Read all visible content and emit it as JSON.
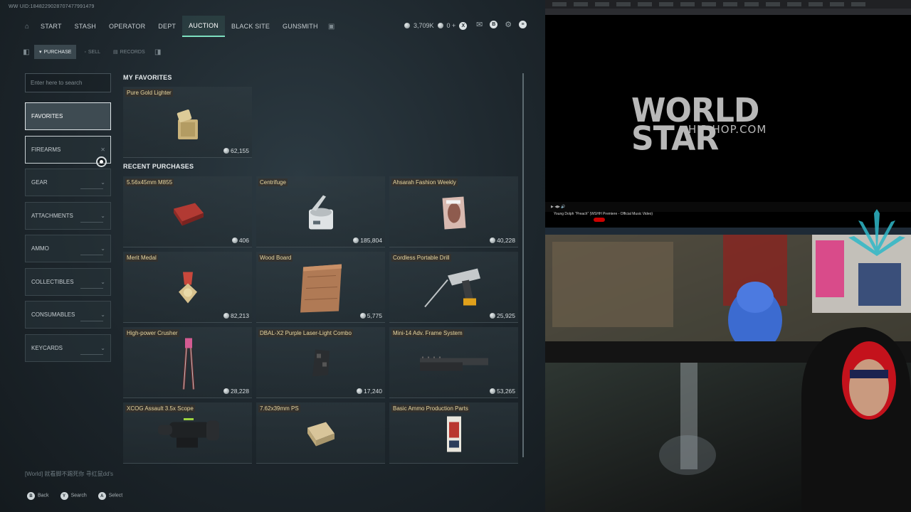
{
  "game": {
    "uid": "WW UID:1848229028707477991479",
    "nav_tabs": [
      "START",
      "STASH",
      "OPERATOR",
      "DEPT",
      "AUCTION",
      "BLACK SITE",
      "GUNSMITH"
    ],
    "active_tab": "AUCTION",
    "currency": {
      "amount": "3,709K",
      "secondary": "0 +"
    },
    "sub_tabs": [
      {
        "label": "PURCHASE",
        "icon": "cart-icon"
      },
      {
        "label": "SELL",
        "icon": "sell-icon"
      },
      {
        "label": "RECORDS",
        "icon": "records-icon"
      }
    ],
    "search_placeholder": "Enter here to search",
    "categories": [
      "FAVORITES",
      "FIREARMS",
      "GEAR",
      "ATTACHMENTS",
      "AMMO",
      "COLLECTIBLES",
      "CONSUMABLES",
      "KEYCARDS"
    ],
    "favorites_heading": "MY FAVORITES",
    "favorites": [
      {
        "name": "Pure Gold Lighter",
        "price": "62,155",
        "icon": "lighter"
      }
    ],
    "recent_heading": "RECENT PURCHASES",
    "recent": [
      {
        "name": "5.56x45mm M855",
        "price": "406",
        "icon": "ammo-box"
      },
      {
        "name": "Centrifuge",
        "price": "185,804",
        "icon": "centrifuge"
      },
      {
        "name": "Ahsarah Fashion Weekly",
        "price": "40,228",
        "icon": "magazine"
      },
      {
        "name": "Merit Medal",
        "price": "82,213",
        "icon": "medal"
      },
      {
        "name": "Wood Board",
        "price": "5,775",
        "icon": "wood-board"
      },
      {
        "name": "Cordless Portable Drill",
        "price": "25,925",
        "icon": "drill"
      },
      {
        "name": "High-power Crusher",
        "price": "28,228",
        "icon": "crusher"
      },
      {
        "name": "DBAL-X2 Purple Laser-Light Combo",
        "price": "17,240",
        "icon": "laser"
      },
      {
        "name": "Mini-14 Adv. Frame System",
        "price": "53,265",
        "icon": "rail"
      },
      {
        "name": "XCOG Assault 3.5x Scope",
        "price": "",
        "icon": "scope"
      },
      {
        "name": "7.62x39mm PS",
        "price": "",
        "icon": "ammo-box-2"
      },
      {
        "name": "Basic Ammo Production Parts",
        "price": "",
        "icon": "parts"
      }
    ],
    "chat": "[World] 就看脚不踢死你 寻红鼠dd's",
    "bottom_actions": [
      {
        "key": "B",
        "label": "Back"
      },
      {
        "key": "Y",
        "label": "Search"
      },
      {
        "key": "A",
        "label": "Select"
      }
    ]
  },
  "browser": {
    "logo_main": "WORLD STAR",
    "logo_sub": "HIP HOP.COM",
    "video_title": "Young Dolph \"Preach\" (WSHH Premiere - Official Music Video)"
  }
}
